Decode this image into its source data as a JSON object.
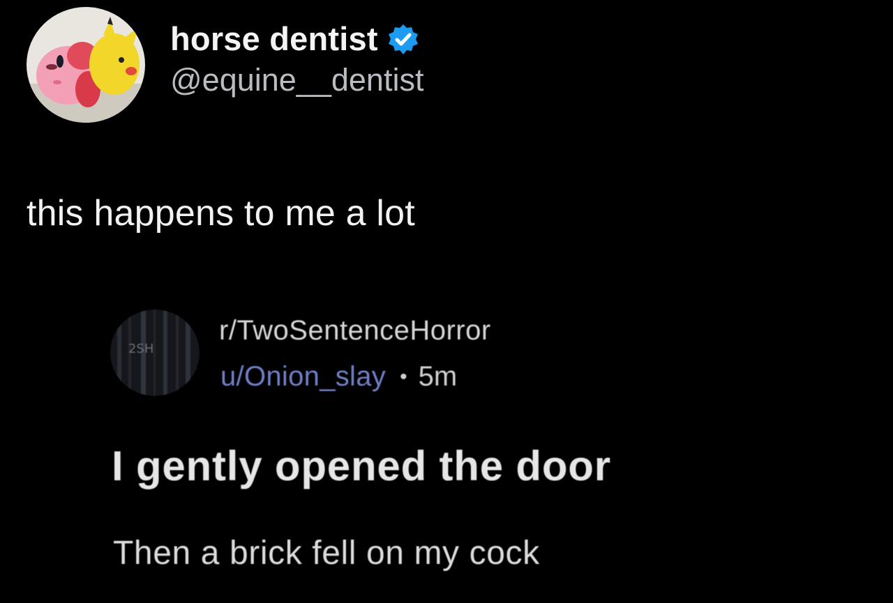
{
  "tweet": {
    "author": {
      "display_name": "horse dentist",
      "handle": "@equine__dentist",
      "verified": true,
      "avatar_icon": "kirby-pikachu-avatar-icon",
      "verified_icon": "verified-badge-icon"
    },
    "text": "this happens to me a lot"
  },
  "quoted_post": {
    "subreddit": "r/TwoSentenceHorror",
    "user": "u/Onion_slay",
    "separator": "•",
    "time": "5m",
    "avatar_icon": "subreddit-avatar-icon",
    "title": "I gently opened the door",
    "body": "Then a brick fell on my cock"
  },
  "colors": {
    "background": "#000000",
    "verified_blue": "#1d9bf0",
    "reddit_user_link": "#6f7fc4",
    "handle_gray": "#b9bcc0"
  }
}
